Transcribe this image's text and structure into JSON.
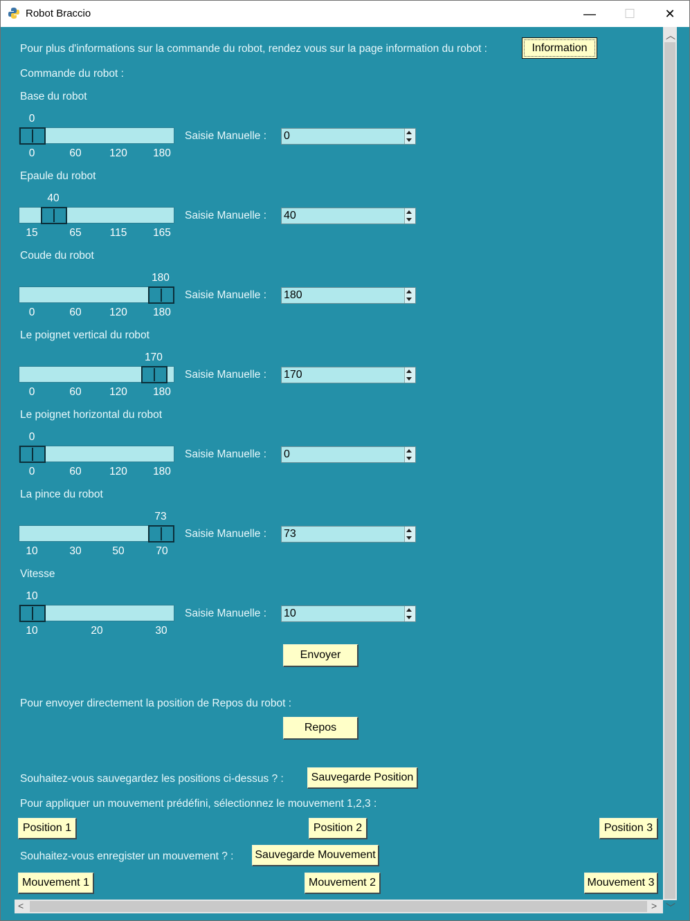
{
  "window": {
    "title": "Robot Braccio",
    "minimize": "—",
    "maximize": "☐",
    "close": "✕"
  },
  "header": {
    "info_text": "Pour plus d'informations sur la commande du robot, rendez vous sur la page information du robot :",
    "info_button": "Information",
    "command_title": "Commande du robot :"
  },
  "spin_label": "Saisie Manuelle :",
  "sliders": [
    {
      "label": "Base du robot",
      "value": "0",
      "ticks": [
        "0",
        "60",
        "120",
        "180"
      ],
      "min": 0,
      "max": 180,
      "current": 0
    },
    {
      "label": "Epaule du robot",
      "value": "40",
      "ticks": [
        "15",
        "65",
        "115",
        "165"
      ],
      "min": 15,
      "max": 165,
      "current": 40
    },
    {
      "label": "Coude du robot",
      "value": "180",
      "ticks": [
        "0",
        "60",
        "120",
        "180"
      ],
      "min": 0,
      "max": 180,
      "current": 180
    },
    {
      "label": "Le poignet vertical du robot",
      "value": "170",
      "ticks": [
        "0",
        "60",
        "120",
        "180"
      ],
      "min": 0,
      "max": 180,
      "current": 170
    },
    {
      "label": "Le poignet horizontal du robot",
      "value": "0",
      "ticks": [
        "0",
        "60",
        "120",
        "180"
      ],
      "min": 0,
      "max": 180,
      "current": 0
    },
    {
      "label": "La pince du robot",
      "value": "73",
      "ticks": [
        "10",
        "30",
        "50",
        "70"
      ],
      "min": 10,
      "max": 73,
      "current": 73
    },
    {
      "label": "Vitesse",
      "value": "10",
      "ticks": [
        "10",
        "20",
        "30"
      ],
      "min": 10,
      "max": 30,
      "current": 10
    }
  ],
  "send_button": "Envoyer",
  "rest": {
    "text": "Pour envoyer directement la position de Repos du robot :",
    "button": "Repos"
  },
  "save_positions": {
    "text": "Souhaitez-vous sauvegardez les positions ci-dessus ? :",
    "button": "Sauvegarde Position"
  },
  "predefined": {
    "text": "Pour appliquer un mouvement prédéfini, sélectionnez le mouvement 1,2,3 :",
    "buttons": [
      "Position 1",
      "Position 2",
      "Position 3"
    ]
  },
  "save_movement": {
    "text": "Souhaitez-vous enregister un mouvement ? :",
    "button": "Sauvegarde Mouvement"
  },
  "movements": [
    "Mouvement 1",
    "Mouvement 2",
    "Mouvement 3"
  ],
  "colors": {
    "background": "#2490a8",
    "button": "#ffffc8",
    "trough": "#b0e8ec"
  }
}
